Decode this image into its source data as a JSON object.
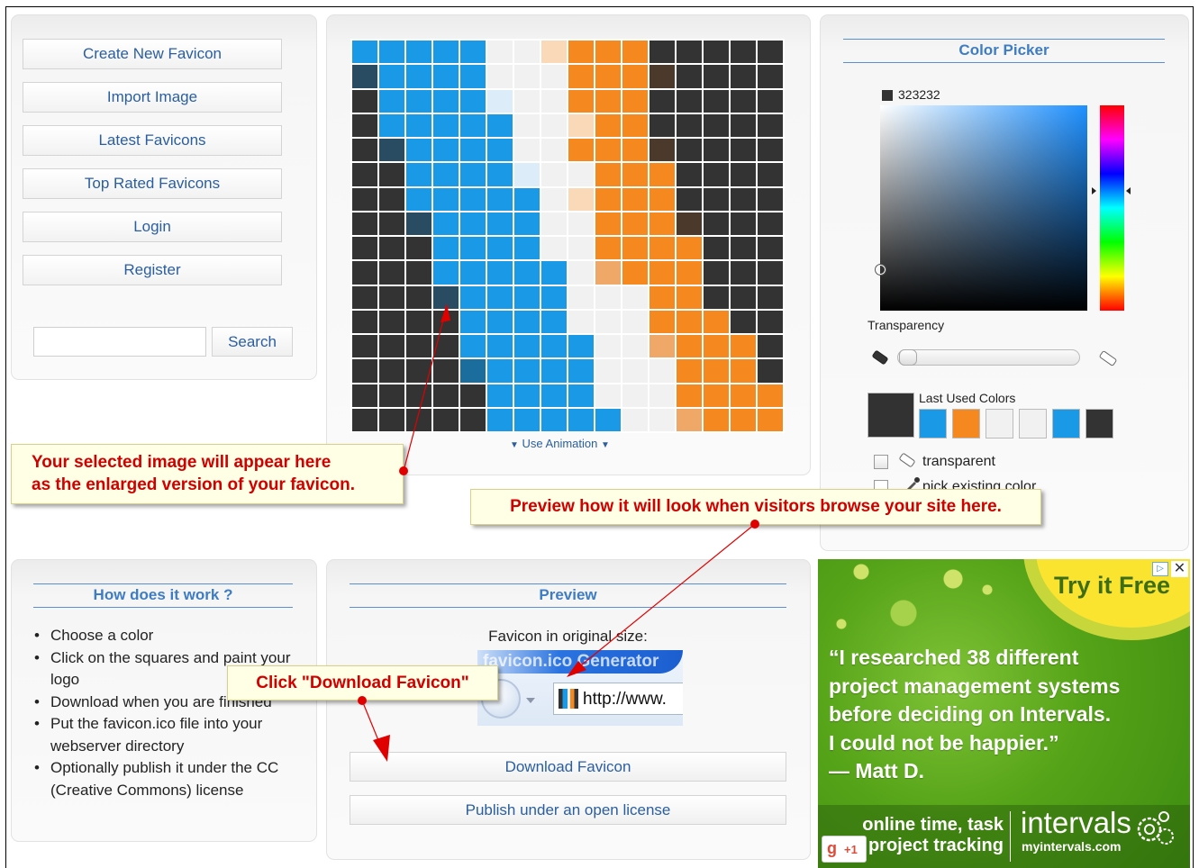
{
  "nav": {
    "create": "Create New Favicon",
    "import": "Import Image",
    "latest": "Latest Favicons",
    "top": "Top Rated Favicons",
    "login": "Login",
    "register": "Register",
    "search_button": "Search",
    "search_value": ""
  },
  "editor": {
    "palette": {
      "B": "#1a9ae6",
      "W": "#f1f1f1",
      "O": "#f5891f",
      "K": "#333333",
      "D": "#2a4c63",
      "L": "#dcecf8",
      "P": "#f9d9b8",
      "T": "#c9d9e8",
      "N": "#4b3a2c",
      "S": "#f0a868",
      "M": "#1b6d9e"
    },
    "rows": [
      "BBBBBWWPOOOKKKKK",
      "DBBBBWWWOOONKKKK",
      "KBBBBLWWOOOKKKKK",
      "KBBBBBWWPOOKKKKK",
      "KDBBBBWWOOONKKKK",
      "KKBBBBLWWOOOKKKK",
      "KKBBBBBWPOOOKKKK",
      "KKDBBBBWWOOONKKK",
      "KKKBBBBWWOOOOKKK",
      "KKKBBBBBWSOOOKKK",
      "KKKDBBBBWWWOOKKK",
      "KKKKBBBBWWWOOOKK",
      "KKKKBBBBBWWSOOOK",
      "KKKKMBBBBWWWOOOK",
      "KKKKKBBBBWWWOOOO",
      "KKKKKBBBBBWWSOOO"
    ],
    "use_animation": "Use Animation"
  },
  "color_picker": {
    "title": "Color Picker",
    "hex": "323232",
    "current_color": "#323232",
    "transparency_label": "Transparency",
    "last_used_label": "Last Used Colors",
    "last_used": [
      "#1a9ae6",
      "#f5891f",
      "#f1f1f1",
      "#f1f1f1",
      "#1a9ae6",
      "#333333"
    ],
    "transparent_label": "transparent",
    "pick_label": "pick existing color"
  },
  "how": {
    "title": "How does it work ?",
    "items": [
      "Choose a color",
      "Click on the squares and paint your logo",
      "Download when you are finished",
      "Put the favicon.ico file into your webserver directory",
      "Optionally publish it under the CC (Creative Commons) license"
    ]
  },
  "preview": {
    "title": "Preview",
    "original_size": "Favicon in original size:",
    "browser_tab_text": "favicon.ico Generator",
    "address_text": "http://www.",
    "download": "Download Favicon",
    "publish": "Publish under an open license"
  },
  "callouts": {
    "enlarged": [
      "Your selected image will appear here",
      "as the enlarged version of your favicon."
    ],
    "preview": "Preview how it will look when visitors browse your site here.",
    "download": "Click \"Download Favicon\""
  },
  "ad": {
    "try": "Try it Free",
    "quote": [
      "“I researched 38 different",
      "project management systems",
      "before deciding on Intervals.",
      "I could not be happier.”",
      "— Matt D."
    ],
    "tagline": [
      "online time, task",
      "project tracking"
    ],
    "brand": "intervals",
    "url": "myintervals.com",
    "plusone": "+1"
  }
}
